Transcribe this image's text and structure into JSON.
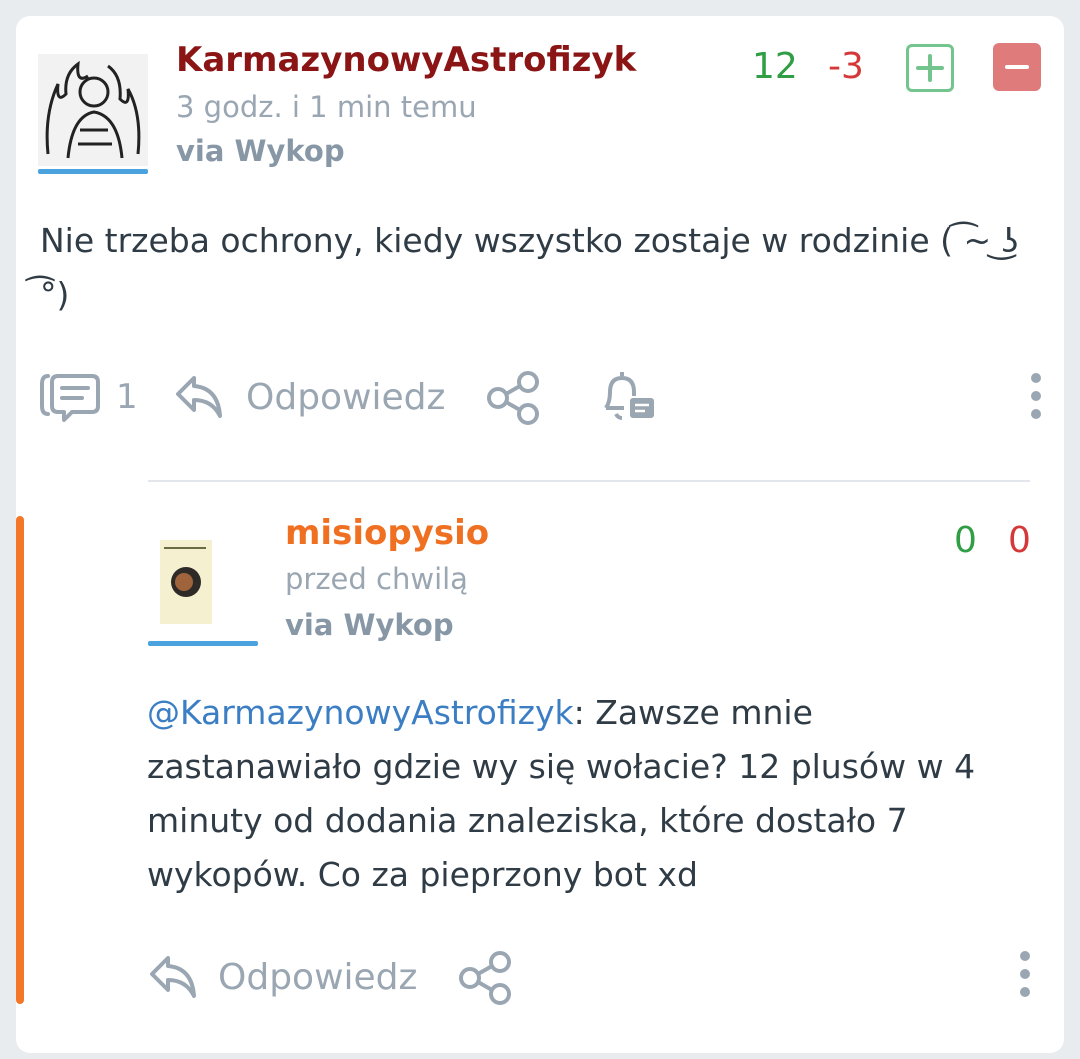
{
  "post": {
    "author": "KarmazynowyAstrofizyk",
    "author_color": "#8b1414",
    "time": "3 godz. i 1 min temu",
    "via": "via Wykop",
    "votes_plus": "12",
    "votes_minus": "-3",
    "content": "Nie trzeba ochrony, kiedy wszystko zostaje w rodzinie ( ͡~ ͜ʖ ͡°)",
    "comments_count": "1",
    "reply_label": "Odpowiedz"
  },
  "reply": {
    "author": "misiopysio",
    "author_color": "#f07022",
    "time": "przed chwilą",
    "via": "via Wykop",
    "votes_plus": "0",
    "votes_minus": "0",
    "mention": "@KarmazynowyAstrofizyk",
    "content": ": Zawsze mnie zastanawiało gdzie wy się wołacie? 12 plusów w 4 minuty od dodania znaleziska, które dostało 7 wykopów. Co za pieprzony bot xd",
    "reply_label": "Odpowiedz"
  },
  "icons": {
    "vote_up": "plus-square-icon",
    "vote_down": "minus-square-icon",
    "comments": "comments-icon",
    "reply": "reply-arrow-icon",
    "share": "share-icon",
    "notify": "bell-icon",
    "more": "more-vertical-icon"
  }
}
